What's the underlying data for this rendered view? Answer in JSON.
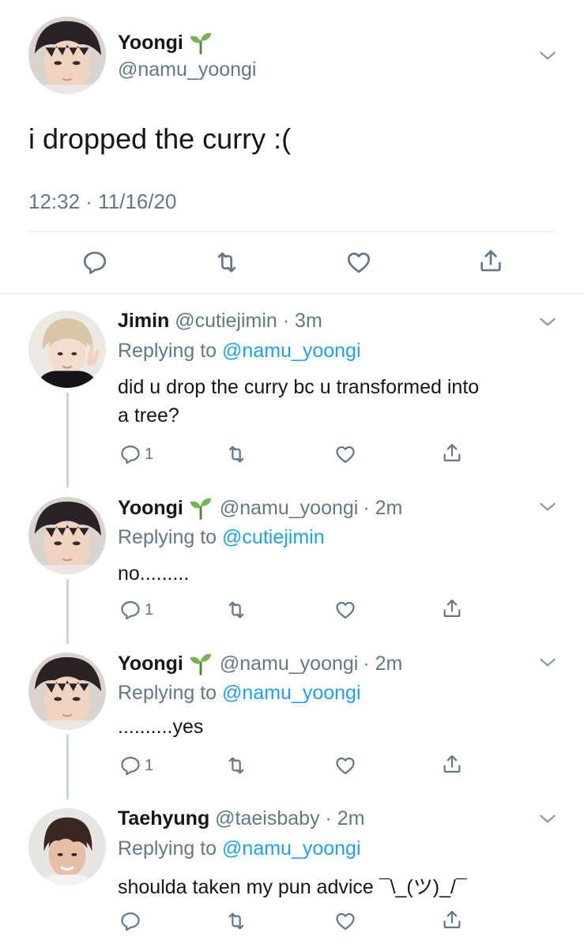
{
  "main_tweet": {
    "name": "Yoongi",
    "handle": "@namu_yoongi",
    "text": "i dropped the curry :(",
    "meta": "12:32 · 11/16/20"
  },
  "replies": [
    {
      "name": "Jimin",
      "handle": "@cutiejimin",
      "time": "· 3m",
      "replying_prefix": "Replying to",
      "replying_to": "@namu_yoongi",
      "text_line1": "did u drop the curry bc u transformed into",
      "text_line2": "a tree?",
      "reply_count": "1"
    },
    {
      "name": "Yoongi",
      "handle": "@namu_yoongi",
      "time": "· 2m",
      "replying_prefix": "Replying to",
      "replying_to": "@cutiejimin",
      "text_line1": "no.........",
      "reply_count": "1"
    },
    {
      "name": "Yoongi",
      "handle": "@namu_yoongi",
      "time": "· 2m",
      "replying_prefix": "Replying to",
      "replying_to": "@namu_yoongi",
      "text_line1": "..........yes",
      "reply_count": "1"
    },
    {
      "name": "Taehyung",
      "handle": "@taeisbaby",
      "time": "· 2m",
      "replying_prefix": "Replying to",
      "replying_to": "@namu_yoongi",
      "text_line1": "shoulda taken my pun advice ¯\\_(ツ)_/¯",
      "reply_count": ""
    }
  ],
  "colors": {
    "link": "#1da1f2",
    "muted": "#657786",
    "divider": "#e1e8ed",
    "thread_line": "#ccd6dd"
  },
  "icons": [
    "seedling-icon",
    "chevron-down-icon",
    "reply-icon",
    "retweet-icon",
    "like-icon",
    "share-icon"
  ]
}
